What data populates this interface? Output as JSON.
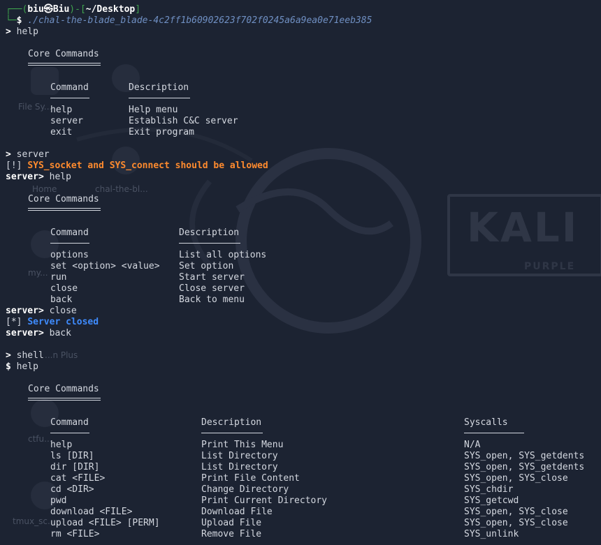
{
  "prompt": {
    "user": "biu",
    "sep": "㉿",
    "host": "Biu",
    "path": "~/Desktop",
    "command": "./chal-the-blade_blade-4c2ff1b60902623f702f0245a6a9ea0e71eeb385"
  },
  "main_session": {
    "prompt_symbol": ">",
    "help_cmd": "help",
    "heading": "Core Commands",
    "col_command": "Command",
    "col_description": "Description",
    "rows": [
      {
        "cmd": "help",
        "desc": "Help menu"
      },
      {
        "cmd": "server",
        "desc": "Establish C&C server"
      },
      {
        "cmd": "exit",
        "desc": "Exit program"
      }
    ],
    "server_cmd": "server",
    "warn_tag": "[!]",
    "warn_text": "SYS_socket and SYS_connect should be allowed"
  },
  "server_session": {
    "prompt": "server>",
    "help_cmd": "help",
    "heading": "Core Commands",
    "col_command": "Command",
    "col_description": "Description",
    "rows": [
      {
        "cmd": "options",
        "desc": "List all options"
      },
      {
        "cmd": "set <option> <value>",
        "desc": "Set option"
      },
      {
        "cmd": "run",
        "desc": "Start server"
      },
      {
        "cmd": "close",
        "desc": "Close server"
      },
      {
        "cmd": "back",
        "desc": "Back to menu"
      }
    ],
    "close_cmd": "close",
    "info_tag": "[*]",
    "info_text": "Server closed",
    "back_cmd": "back"
  },
  "shell_session": {
    "entry_prompt": ">",
    "shell_cmd": "shell",
    "prompt": "$",
    "help_cmd": "help",
    "heading": "Core Commands",
    "col_command": "Command",
    "col_description": "Description",
    "col_syscalls": "Syscalls",
    "rows": [
      {
        "cmd": "help",
        "desc": "Print This Menu",
        "sys": "N/A"
      },
      {
        "cmd": "ls [DIR]",
        "desc": "List Directory",
        "sys": "SYS_open, SYS_getdents"
      },
      {
        "cmd": "dir [DIR]",
        "desc": "List Directory",
        "sys": "SYS_open, SYS_getdents"
      },
      {
        "cmd": "cat <FILE>",
        "desc": "Print File Content",
        "sys": "SYS_open, SYS_close"
      },
      {
        "cmd": "cd <DIR>",
        "desc": "Change Directory",
        "sys": "SYS_chdir"
      },
      {
        "cmd": "pwd",
        "desc": "Print Current Directory",
        "sys": "SYS_getcwd"
      },
      {
        "cmd": "download <FILE>",
        "desc": "Download File",
        "sys": "SYS_open, SYS_close"
      },
      {
        "cmd": "upload <FILE> [PERM]",
        "desc": "Upload File",
        "sys": "SYS_open, SYS_close"
      },
      {
        "cmd": "rm <FILE>",
        "desc": "Remove File",
        "sys": "SYS_unlink"
      }
    ]
  },
  "desktop": {
    "icons": [
      {
        "label": "File Sy..."
      },
      {
        "label": "Home"
      },
      {
        "label": "chal-the-bl..."
      },
      {
        "label": "my..."
      },
      {
        "label": "...n Plus"
      },
      {
        "label": "ctfu..."
      },
      {
        "label": "tmux_sc..."
      }
    ],
    "wallpaper_logo": "KALI",
    "wallpaper_sub": "PURPLE"
  },
  "colors": {
    "background": "#1c2332",
    "prompt_green": "#3fa34d",
    "prompt_blue": "#4aa3ff",
    "warning": "#ff8b2e",
    "info": "#3f8cff"
  }
}
